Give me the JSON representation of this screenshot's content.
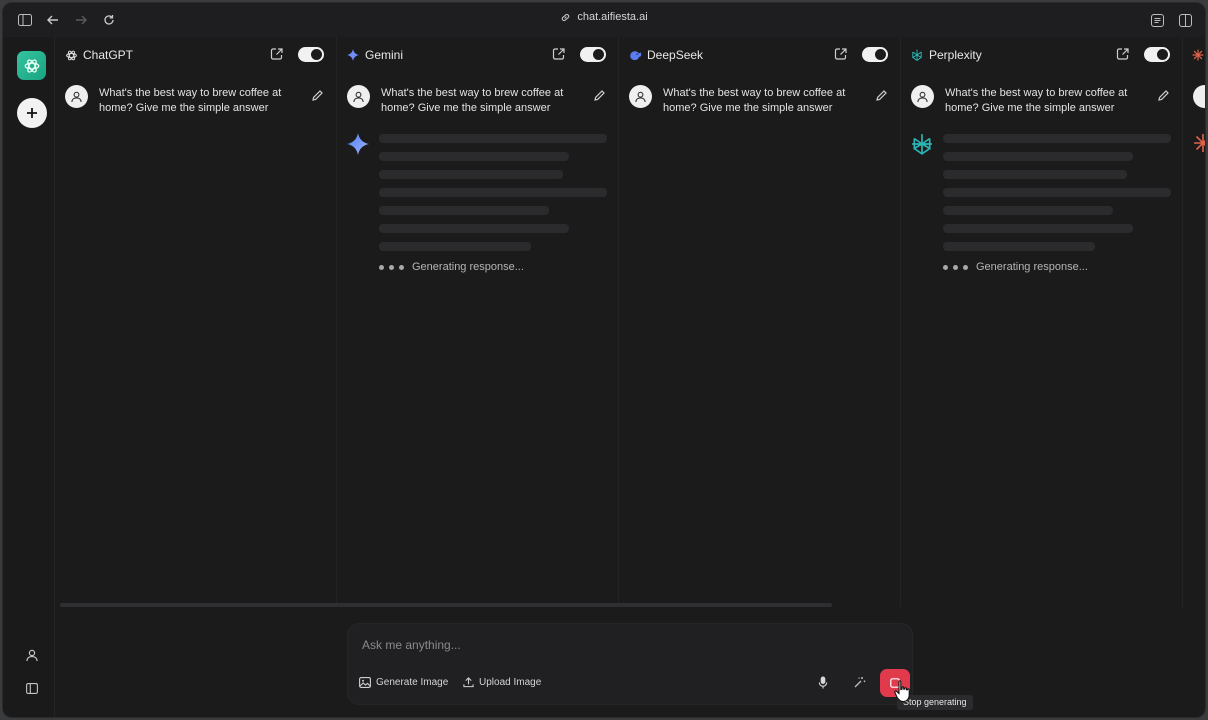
{
  "browser": {
    "url": "chat.aifiesta.ai"
  },
  "models": [
    {
      "name": "ChatGPT",
      "icon": "chatgpt-icon",
      "prompt": "What's the best way to brew coffee at home? Give me the simple answer",
      "status": ""
    },
    {
      "name": "Gemini",
      "icon": "gemini-sparkle-icon",
      "prompt": "What's the best way to brew coffee at home? Give me the simple answer",
      "status": "Generating response..."
    },
    {
      "name": "DeepSeek",
      "icon": "deepseek-icon",
      "prompt": "What's the best way to brew coffee at home? Give me the simple answer",
      "status": ""
    },
    {
      "name": "Perplexity",
      "icon": "perplexity-icon",
      "prompt": "What's the best way to brew coffee at home? Give me the simple answer",
      "status": "Generating response..."
    }
  ],
  "composer": {
    "placeholder": "Ask me anything...",
    "generate_image": "Generate Image",
    "upload_image": "Upload Image",
    "stop_tooltip": "Stop generating"
  },
  "colors": {
    "accent_stop": "#e23a4d",
    "logo": "#21b08c",
    "gemini": "#5c86f5",
    "perplexity": "#2bb5b5"
  }
}
